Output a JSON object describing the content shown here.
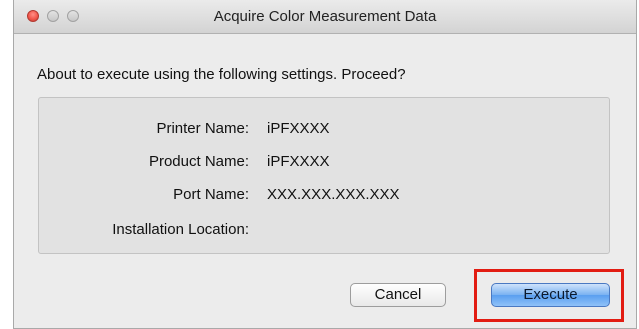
{
  "window": {
    "title": "Acquire Color Measurement Data"
  },
  "prompt": "About to execute using the following settings. Proceed?",
  "settings": [
    {
      "label": "Printer Name:",
      "value": "iPFXXXX"
    },
    {
      "label": "Product Name:",
      "value": "iPFXXXX"
    },
    {
      "label": "Port Name:",
      "value": "XXX.XXX.XXX.XXX"
    },
    {
      "label": "Installation Location:",
      "value": ""
    }
  ],
  "buttons": {
    "cancel": "Cancel",
    "execute": "Execute"
  },
  "colors": {
    "highlight": "#e21c12",
    "default_button": "#79b2f2",
    "close_button": "#f2584d"
  }
}
